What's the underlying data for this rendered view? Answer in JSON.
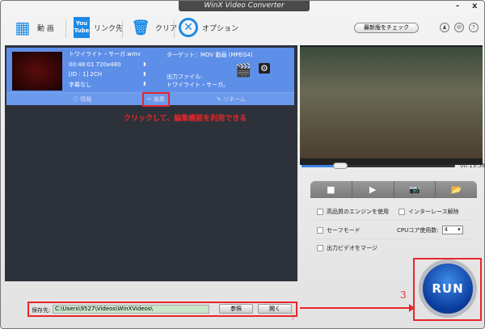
{
  "window": {
    "title": "WinX Video Converter",
    "minimize": "-",
    "close": "x"
  },
  "toolbar": {
    "video": "動 画",
    "youtube_icon": "You Tube",
    "link": "リンク先",
    "clear": "クリア",
    "option": "オプション",
    "update": "最新版をチェック",
    "icons": [
      "user-icon",
      "mail-icon",
      "help-icon"
    ],
    "user": "♟",
    "mail": "✉",
    "help": "?"
  },
  "file": {
    "name": "トワイライト・サーガ.wmv",
    "duration": "00:48:01 720x480",
    "audio": "[ID : 1] 2CH",
    "subtitle": "字幕なし",
    "target": "ターゲット：MOV 動画 (MPEG4)",
    "output_label": "出力ファイル:",
    "output_name": "トワイライト・サーガ。",
    "info": "情報",
    "edit": "編集",
    "rename": "リネーム"
  },
  "annotation": {
    "text": "クリックして、編集機能を利用できる",
    "step": "3"
  },
  "player": {
    "time": "00:13:58",
    "progress": 0.25
  },
  "options": {
    "hq_engine": "高品質のエンジンを使用",
    "deinterlace": "インターレース解除",
    "safe_mode": "セーフモード",
    "cpu_label": "CPUコア使用数:",
    "cpu_value": "4",
    "merge": "出力ビデオをマージ"
  },
  "run": "RUN",
  "save": {
    "label": "保存先:",
    "path": "C:\\Users\\9527\\Videos\\WinXVideos\\",
    "browse": "参照",
    "open": "開く"
  },
  "colors": {
    "accent": "#5e8fe8",
    "annotation": "#e8262a",
    "run": "#0a3a9a"
  }
}
